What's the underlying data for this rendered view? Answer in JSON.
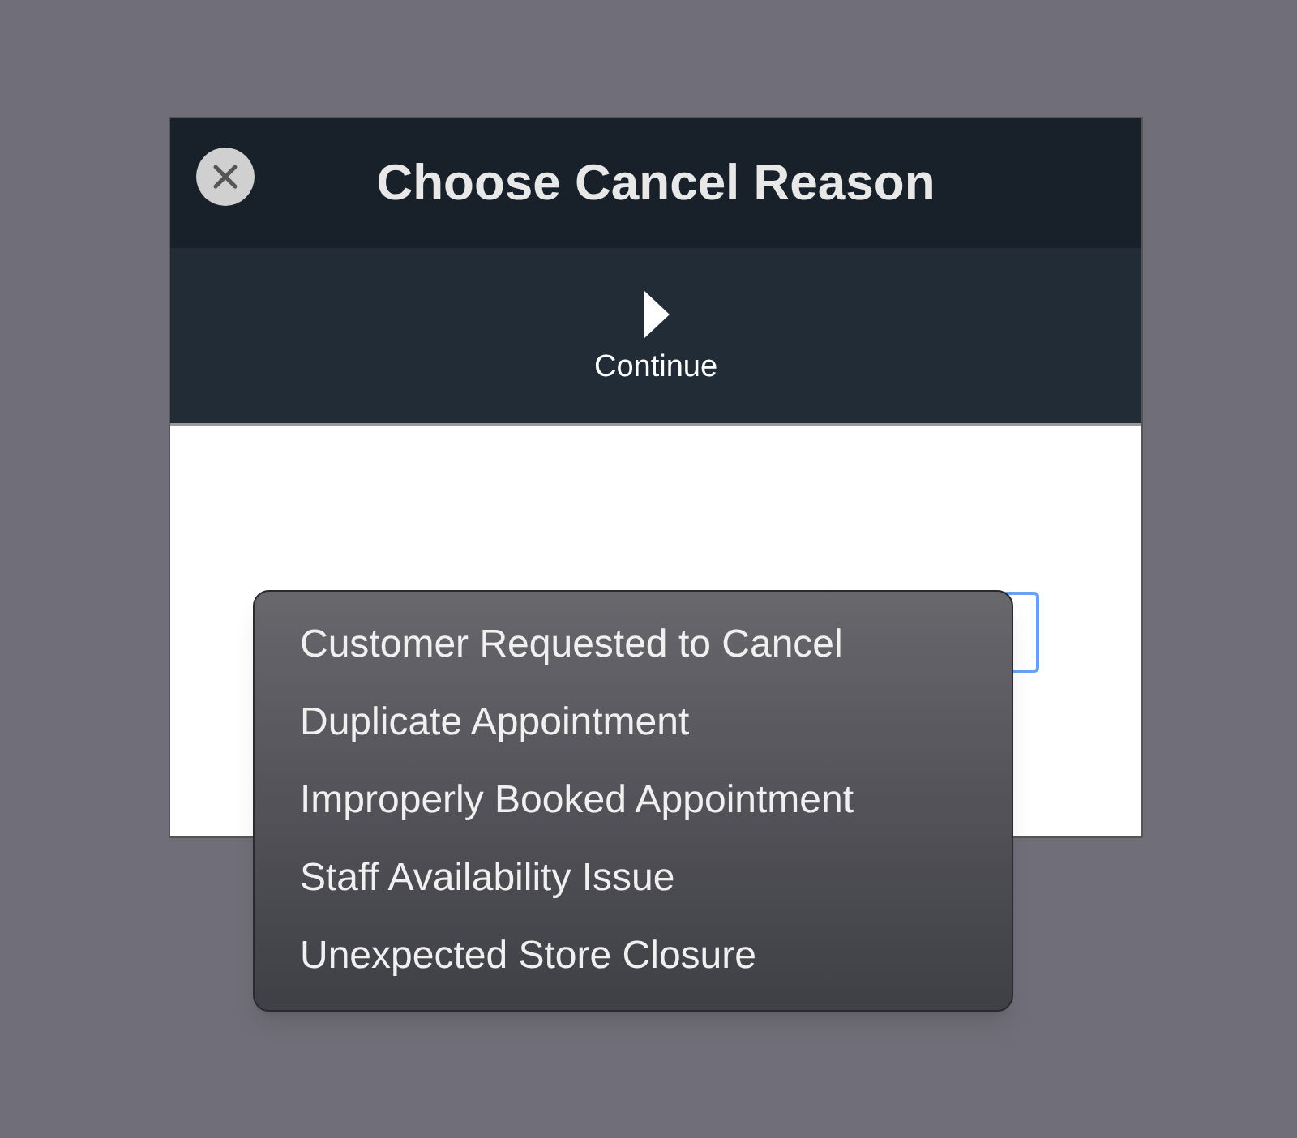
{
  "dialog": {
    "title": "Choose Cancel Reason",
    "toolbar": {
      "continue_button": "Continue"
    }
  },
  "menu": {
    "items": [
      "Customer Requested to Cancel",
      "Duplicate Appointment",
      "Improperly Booked Appointment",
      "Staff Availability Issue",
      "Unexpected Store Closure"
    ]
  }
}
